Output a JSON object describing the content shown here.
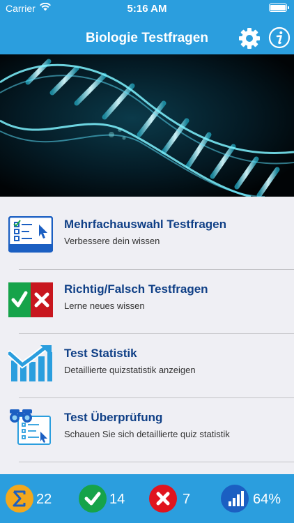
{
  "status_bar": {
    "carrier": "Carrier",
    "time": "5:16 AM"
  },
  "navbar": {
    "title": "Biologie Testfragen",
    "settings_icon": "gear-icon",
    "info_icon": "info-icon"
  },
  "hero": {
    "image": "dna-double-helix"
  },
  "menu": {
    "items": [
      {
        "title": "Mehrfachauswahl Testfragen",
        "subtitle": "Verbessere dein wissen",
        "icon": "multiple-choice-icon"
      },
      {
        "title": "Richtig/Falsch Testfragen",
        "subtitle": "Lerne neues wissen",
        "icon": "true-false-icon"
      },
      {
        "title": "Test Statistik",
        "subtitle": "Detaillierte quizstatistik anzeigen",
        "icon": "statistics-chart-icon"
      },
      {
        "title": "Test Überprüfung",
        "subtitle": "Schauen Sie sich detaillierte quiz statistik",
        "icon": "review-binoculars-icon"
      }
    ]
  },
  "stats": {
    "total": "22",
    "correct": "14",
    "wrong": "7",
    "percent": "64%"
  },
  "colors": {
    "bar_blue": "#2b9ede",
    "title_navy": "#0f3f86",
    "check_green": "#16a34a",
    "cross_red": "#e0141e",
    "sum_orange": "#f3a81c",
    "chart_blue": "#1b5fc2"
  }
}
